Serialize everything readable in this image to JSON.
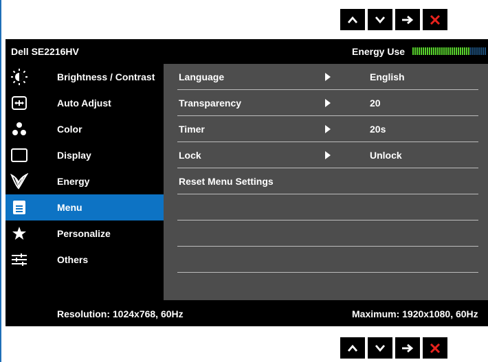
{
  "header": {
    "model": "Dell SE2216HV",
    "energy_label": "Energy Use",
    "energy_level": 0.78
  },
  "colors": {
    "accent": "#0d73c4",
    "panel": "#4d4d4d",
    "close": "#e8221d",
    "energy_on": "#57d12c"
  },
  "buttons": [
    {
      "icon": "chevron-up-icon"
    },
    {
      "icon": "chevron-down-icon"
    },
    {
      "icon": "arrow-right-icon"
    },
    {
      "icon": "close-icon"
    }
  ],
  "sidebar": {
    "items": [
      {
        "label": "Brightness / Contrast",
        "icon": "brightness-icon",
        "active": false
      },
      {
        "label": "Auto Adjust",
        "icon": "auto-adjust-icon",
        "active": false
      },
      {
        "label": "Color",
        "icon": "color-icon",
        "active": false
      },
      {
        "label": "Display",
        "icon": "display-icon",
        "active": false
      },
      {
        "label": "Energy",
        "icon": "energy-leaf-icon",
        "active": false
      },
      {
        "label": "Menu",
        "icon": "menu-icon",
        "active": true
      },
      {
        "label": "Personalize",
        "icon": "star-icon",
        "active": false
      },
      {
        "label": "Others",
        "icon": "sliders-icon",
        "active": false
      }
    ]
  },
  "menu_settings": {
    "rows": [
      {
        "label": "Language",
        "value": "English",
        "has_arrow": true
      },
      {
        "label": "Transparency",
        "value": "20",
        "has_arrow": true
      },
      {
        "label": "Timer",
        "value": "20s",
        "has_arrow": true
      },
      {
        "label": "Lock",
        "value": "Unlock",
        "has_arrow": true
      },
      {
        "label": "Reset Menu Settings",
        "value": "",
        "has_arrow": false
      }
    ],
    "empty_rows": 3
  },
  "footer": {
    "resolution": "Resolution: 1024x768, 60Hz",
    "maximum": "Maximum: 1920x1080, 60Hz"
  }
}
